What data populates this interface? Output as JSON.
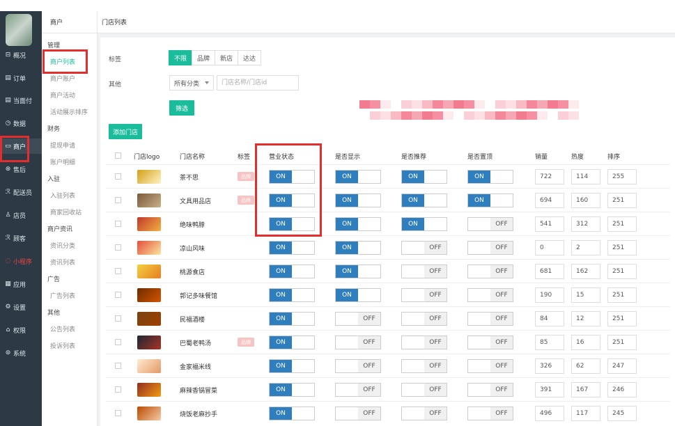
{
  "colors": {
    "accent": "#1abc9c",
    "switch_on": "#2f7fbf",
    "highlight": "#e42d2d",
    "nav_bg": "#2d3a45"
  },
  "nav": [
    {
      "icon": "⊟",
      "label": "概况"
    },
    {
      "icon": "▤",
      "label": "订单"
    },
    {
      "icon": "▤",
      "label": "当面付"
    },
    {
      "icon": "◷",
      "label": "数据"
    },
    {
      "icon": "▭",
      "label": "商户"
    },
    {
      "icon": "⊛",
      "label": "售后"
    },
    {
      "icon": "ℛ",
      "label": "配送员"
    },
    {
      "icon": "♙",
      "label": "店员"
    },
    {
      "icon": "ℛ",
      "label": "顾客"
    },
    {
      "icon": "◌",
      "label": "小程序"
    },
    {
      "icon": "▦",
      "label": "应用"
    },
    {
      "icon": "⚙",
      "label": "设置"
    },
    {
      "icon": "⌂",
      "label": "权限"
    },
    {
      "icon": "⊚",
      "label": "系统"
    }
  ],
  "subnav": {
    "title": "商户",
    "groups": [
      {
        "label": "管理",
        "links": [
          "商户列表",
          "商户账户",
          "商户活动",
          "活动展示排序"
        ]
      },
      {
        "label": "财务",
        "links": [
          "提现申请",
          "账户明细"
        ]
      },
      {
        "label": "入驻",
        "links": [
          "入驻列表",
          "商家回收站"
        ]
      },
      {
        "label": "商户资讯",
        "links": [
          "资讯分类",
          "资讯列表"
        ]
      },
      {
        "label": "广告",
        "links": [
          "广告列表"
        ]
      },
      {
        "label": "其他",
        "links": [
          "公告列表",
          "投诉列表"
        ]
      }
    ]
  },
  "breadcrumb": "门店列表",
  "filters": {
    "tag_label": "标签",
    "tags": [
      "不限",
      "品牌",
      "新店",
      "达达"
    ],
    "other_label": "其他",
    "category_select": "所有分类",
    "search_placeholder": "门店名称/门店id",
    "filter_button": "筛选"
  },
  "add_button": "添加门店",
  "table": {
    "headers": [
      "门店logo",
      "门店名称",
      "标签",
      "营业状态",
      "是否显示",
      "是否推荐",
      "是否置顶",
      "销量",
      "热度",
      "排序"
    ],
    "on_label": "ON",
    "off_label": "OFF",
    "rows": [
      {
        "name": "茶不思",
        "tag": "品牌",
        "status": true,
        "show": true,
        "recommend": true,
        "top": true,
        "sales": "722",
        "heat": "114",
        "sort": "255"
      },
      {
        "name": "文具用品店",
        "tag": "品牌",
        "status": true,
        "show": true,
        "recommend": true,
        "top": true,
        "sales": "694",
        "heat": "160",
        "sort": "251"
      },
      {
        "name": "绝味鸭脖",
        "tag": "",
        "status": true,
        "show": true,
        "recommend": true,
        "top": false,
        "sales": "541",
        "heat": "312",
        "sort": "251"
      },
      {
        "name": "凉山风味",
        "tag": "",
        "status": true,
        "show": true,
        "recommend": false,
        "top": false,
        "sales": "0",
        "heat": "2",
        "sort": "251"
      },
      {
        "name": "桃源食店",
        "tag": "",
        "status": true,
        "show": true,
        "recommend": false,
        "top": false,
        "sales": "681",
        "heat": "162",
        "sort": "251"
      },
      {
        "name": "郭记多味餐馆",
        "tag": "",
        "status": true,
        "show": true,
        "recommend": false,
        "top": false,
        "sales": "190",
        "heat": "15",
        "sort": "251"
      },
      {
        "name": "民福酒楼",
        "tag": "",
        "status": true,
        "show": false,
        "recommend": false,
        "top": false,
        "sales": "84",
        "heat": "12",
        "sort": "251"
      },
      {
        "name": "巴蜀老鸭汤",
        "tag": "品牌",
        "status": true,
        "show": false,
        "recommend": false,
        "top": false,
        "sales": "85",
        "heat": "16",
        "sort": "251"
      },
      {
        "name": "金家福米线",
        "tag": "",
        "status": true,
        "show": false,
        "recommend": false,
        "top": false,
        "sales": "326",
        "heat": "62",
        "sort": "247"
      },
      {
        "name": "麻辣香锅冒菜",
        "tag": "",
        "status": true,
        "show": false,
        "recommend": false,
        "top": false,
        "sales": "391",
        "heat": "167",
        "sort": "246"
      },
      {
        "name": "烧饭老麻抄手",
        "tag": "",
        "status": true,
        "show": false,
        "recommend": false,
        "top": false,
        "sales": "496",
        "heat": "117",
        "sort": "245"
      }
    ]
  }
}
